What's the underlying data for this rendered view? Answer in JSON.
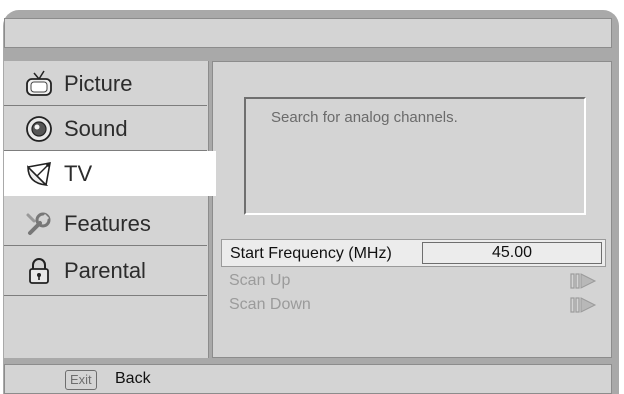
{
  "sidebar": {
    "items": [
      {
        "label": "Picture",
        "icon": "tv-set-icon"
      },
      {
        "label": "Sound",
        "icon": "speaker-icon"
      },
      {
        "label": "TV",
        "icon": "satellite-dish-icon",
        "active": true
      },
      {
        "label": "Features",
        "icon": "wrench-icon"
      },
      {
        "label": "Parental",
        "icon": "padlock-icon"
      }
    ]
  },
  "content": {
    "info_text": "Search for analog channels.",
    "start_frequency_label": "Start Frequency (MHz)",
    "start_frequency_value": "45.00",
    "scan_up_label": "Scan Up",
    "scan_down_label": "Scan Down"
  },
  "footer": {
    "exit_key": "Exit",
    "back_label": "Back"
  },
  "colors": {
    "frame": "#a9a9a9",
    "panel": "#d4d4d4",
    "active_item": "#ffffff",
    "disabled_text": "#9b9b9b"
  }
}
